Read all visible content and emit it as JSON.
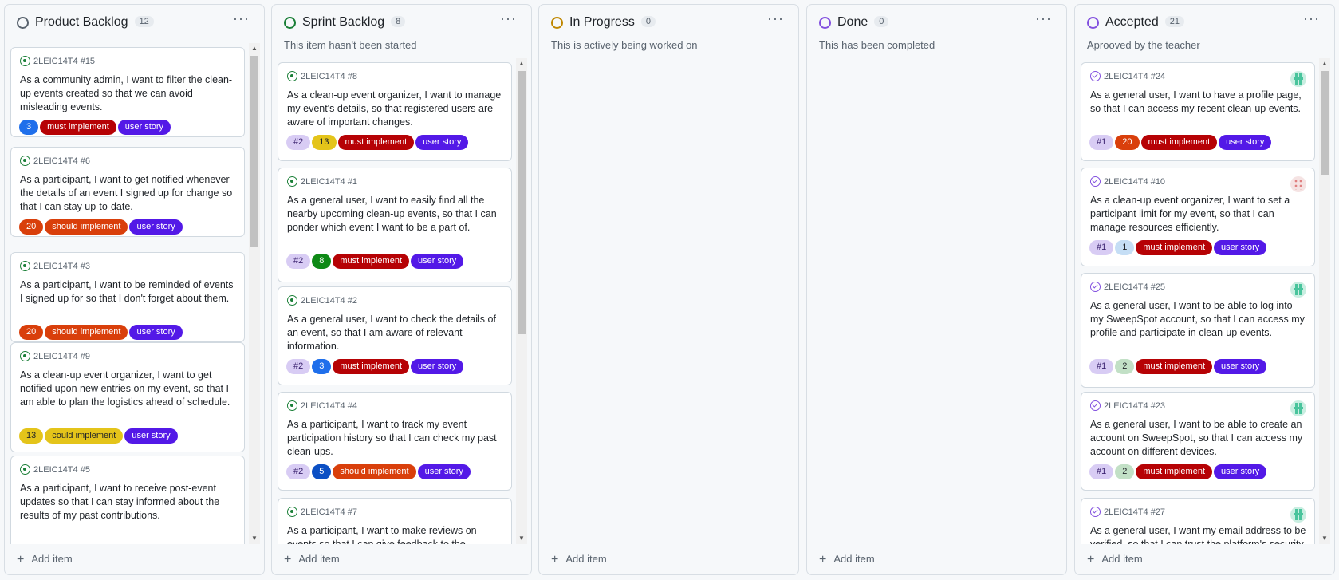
{
  "columns": [
    {
      "title": "Product Backlog",
      "count": "12",
      "description": "",
      "status_color": "#59636e",
      "add_label": "Add item",
      "cards": [
        {
          "ref": "2LEIC14T4 #15",
          "text": "As a community admin, I want to filter the clean-up events created so that we can avoid misleading events.",
          "sprint": "",
          "points": "3",
          "points_color": "#1f6feb",
          "points_text": "#ffffff",
          "priority": "must implement",
          "priority_class": "lbl-must",
          "type": "user story",
          "closed": false
        },
        {
          "ref": "2LEIC14T4 #6",
          "text": "As a participant, I want to get notified whenever the details of an event I signed up for change so that I can stay up-to-date.",
          "sprint": "",
          "points": "20",
          "points_color": "#d93f0b",
          "points_text": "#ffffff",
          "priority": "should implement",
          "priority_class": "lbl-should",
          "type": "user story",
          "closed": false
        },
        {
          "ref": "2LEIC14T4 #3",
          "text": "As a participant, I want to be reminded of events I signed up for so that I don't forget about them.",
          "sprint": "",
          "points": "20",
          "points_color": "#d93f0b",
          "points_text": "#ffffff",
          "priority": "should implement",
          "priority_class": "lbl-should",
          "type": "user story",
          "closed": false
        },
        {
          "ref": "2LEIC14T4 #9",
          "text": "As a clean-up event organizer, I want to get notified upon new entries on my event, so that I am able to plan the logistics ahead of schedule.",
          "sprint": "",
          "points": "13",
          "points_color": "#e4c41a",
          "points_text": "#1f2328",
          "priority": "could implement",
          "priority_class": "lbl-could",
          "type": "user story",
          "closed": false
        },
        {
          "ref": "2LEIC14T4 #5",
          "text": "As a participant, I want to receive post-event updates so that I can stay informed about the results of my past contributions.",
          "sprint": "",
          "points": "",
          "points_color": "#ffffff",
          "points_text": "#1f2328",
          "priority": "",
          "priority_class": "lbl-must",
          "type": "",
          "closed": false
        }
      ]
    },
    {
      "title": "Sprint Backlog",
      "count": "8",
      "description": "This item hasn't been started",
      "status_color": "#1a7f37",
      "add_label": "Add item",
      "cards": [
        {
          "ref": "2LEIC14T4 #8",
          "text": "As a clean-up event organizer, I want to manage my event's details, so that registered users are aware of important changes.",
          "sprint": "#2",
          "points": "13",
          "points_color": "#e4c41a",
          "points_text": "#1f2328",
          "priority": "must implement",
          "priority_class": "lbl-must",
          "type": "user story",
          "closed": false
        },
        {
          "ref": "2LEIC14T4 #1",
          "text": "As a general user, I want to easily find all the nearby upcoming clean-up events, so that I can ponder which event I want to be a part of.",
          "sprint": "#2",
          "points": "8",
          "points_color": "#0e8a16",
          "points_text": "#ffffff",
          "priority": "must implement",
          "priority_class": "lbl-must",
          "type": "user story",
          "closed": false
        },
        {
          "ref": "2LEIC14T4 #2",
          "text": "As a general user, I want to check the details of an event, so that I am aware of relevant information.",
          "sprint": "#2",
          "points": "3",
          "points_color": "#1f6feb",
          "points_text": "#ffffff",
          "priority": "must implement",
          "priority_class": "lbl-must",
          "type": "user story",
          "closed": false
        },
        {
          "ref": "2LEIC14T4 #4",
          "text": "As a participant, I want to track my event participation history so that I can check my past clean-ups.",
          "sprint": "#2",
          "points": "5",
          "points_color": "#0b4fc4",
          "points_text": "#ffffff",
          "priority": "should implement",
          "priority_class": "lbl-should",
          "type": "user story",
          "closed": false
        },
        {
          "ref": "2LEIC14T4 #7",
          "text": "As a participant, I want to make reviews on events so that I can give feedback to the organizers.",
          "sprint": "",
          "points": "",
          "points_color": "#ffffff",
          "points_text": "#1f2328",
          "priority": "",
          "priority_class": "lbl-must",
          "type": "",
          "closed": false
        }
      ]
    },
    {
      "title": "In Progress",
      "count": "0",
      "description": "This is actively being worked on",
      "status_color": "#bf8700",
      "add_label": "Add item",
      "cards": []
    },
    {
      "title": "Done",
      "count": "0",
      "description": "This has been completed",
      "status_color": "#8250df",
      "add_label": "Add item",
      "cards": []
    },
    {
      "title": "Accepted",
      "count": "21",
      "description": "Aprooved by the teacher",
      "status_color": "#8250df",
      "add_label": "Add item",
      "cards": [
        {
          "ref": "2LEIC14T4 #24",
          "text": "As a general user, I want to have a profile page, so that I can access my recent clean-up events.",
          "sprint": "#1",
          "points": "20",
          "points_color": "#d93f0b",
          "points_text": "#ffffff",
          "priority": "must implement",
          "priority_class": "lbl-must",
          "type": "user story",
          "closed": true,
          "avatar": "green"
        },
        {
          "ref": "2LEIC14T4 #10",
          "text": "As a clean-up event organizer, I want to set a participant limit for my event, so that I can manage resources efficiently.",
          "sprint": "#1",
          "points": "1",
          "points_color": "#c5def5",
          "points_text": "#1f2328",
          "priority": "must implement",
          "priority_class": "lbl-must",
          "type": "user story",
          "closed": true,
          "avatar": "pink"
        },
        {
          "ref": "2LEIC14T4 #25",
          "text": "As a general user, I want to be able to log into my SweepSpot account, so that I can access my profile and participate in clean-up events.",
          "sprint": "#1",
          "points": "2",
          "points_color": "#c2e0c6",
          "points_text": "#1f2328",
          "priority": "must implement",
          "priority_class": "lbl-must",
          "type": "user story",
          "closed": true,
          "avatar": "green"
        },
        {
          "ref": "2LEIC14T4 #23",
          "text": "As a general user, I want to be able to create an account on SweepSpot, so that I can access my account on different devices.",
          "sprint": "#1",
          "points": "2",
          "points_color": "#c2e0c6",
          "points_text": "#1f2328",
          "priority": "must implement",
          "priority_class": "lbl-must",
          "type": "user story",
          "closed": true,
          "avatar": "green"
        },
        {
          "ref": "2LEIC14T4 #27",
          "text": "As a general user, I want my email address to be verified, so that I can trust the platform's security.",
          "sprint": "",
          "points": "",
          "points_color": "#ffffff",
          "points_text": "#1f2328",
          "priority": "",
          "priority_class": "lbl-must",
          "type": "",
          "closed": true,
          "avatar": "green"
        }
      ]
    }
  ]
}
